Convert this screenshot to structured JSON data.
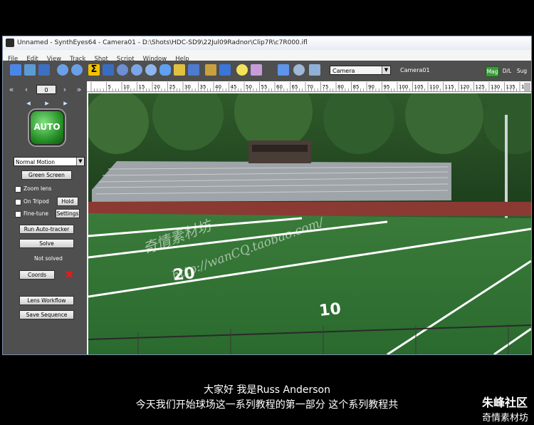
{
  "window": {
    "title": "Unnamed - SynthEyes64 - Camera01 - D:\\Shots\\HDC-SD9\\22Jul09Radnor\\Clip7R\\c7R000.ifl"
  },
  "menu": [
    "File",
    "Edit",
    "View",
    "Track",
    "Shot",
    "Script",
    "Window",
    "Help"
  ],
  "toolbar": {
    "camera_select": "Camera",
    "camera_name": "Camera01",
    "mag_label": "Mag",
    "dl_label": "D/L",
    "sug_label": "Sug"
  },
  "timeline": {
    "ticks": [
      "5",
      "10",
      "15",
      "20",
      "25",
      "30",
      "35",
      "40",
      "45",
      "50",
      "55",
      "60",
      "65",
      "70",
      "75",
      "80",
      "85",
      "90",
      "95",
      "100",
      "105",
      "110",
      "115",
      "120",
      "125",
      "130",
      "135",
      "140"
    ]
  },
  "left_panel": {
    "frame_value": "0",
    "auto_label": "AUTO",
    "motion_select": "Normal Motion",
    "green_screen": "Green Screen",
    "zoom_lens": "Zoom lens",
    "on_tripod": "On Tripod",
    "hold": "Hold",
    "fine_tune": "Fine-tune",
    "settings": "Settings",
    "run_autotracker": "Run Auto-tracker",
    "solve": "Solve",
    "status": "Not solved",
    "coords": "Coords",
    "lens_workflow": "Lens Workflow",
    "save_sequence": "Save Sequence"
  },
  "viewport": {
    "watermark_1": "奇情素材坊",
    "watermark_2": "http://wanCQ.taobao.com/",
    "field_numbers": [
      "20",
      "10"
    ]
  },
  "subtitles": {
    "line1": "大家好 我是Russ Anderson",
    "line2": "今天我们开始球场这一系列教程的第一部分 这个系列教程共"
  },
  "logo": {
    "line1": "朱峰社区",
    "line2": "奇情素材坊"
  },
  "colors": {
    "panel": "#4f4f4f",
    "accent_green": "#3e9a3e",
    "field_green": "#2e6b2f",
    "track_red": "#8a3a32"
  }
}
